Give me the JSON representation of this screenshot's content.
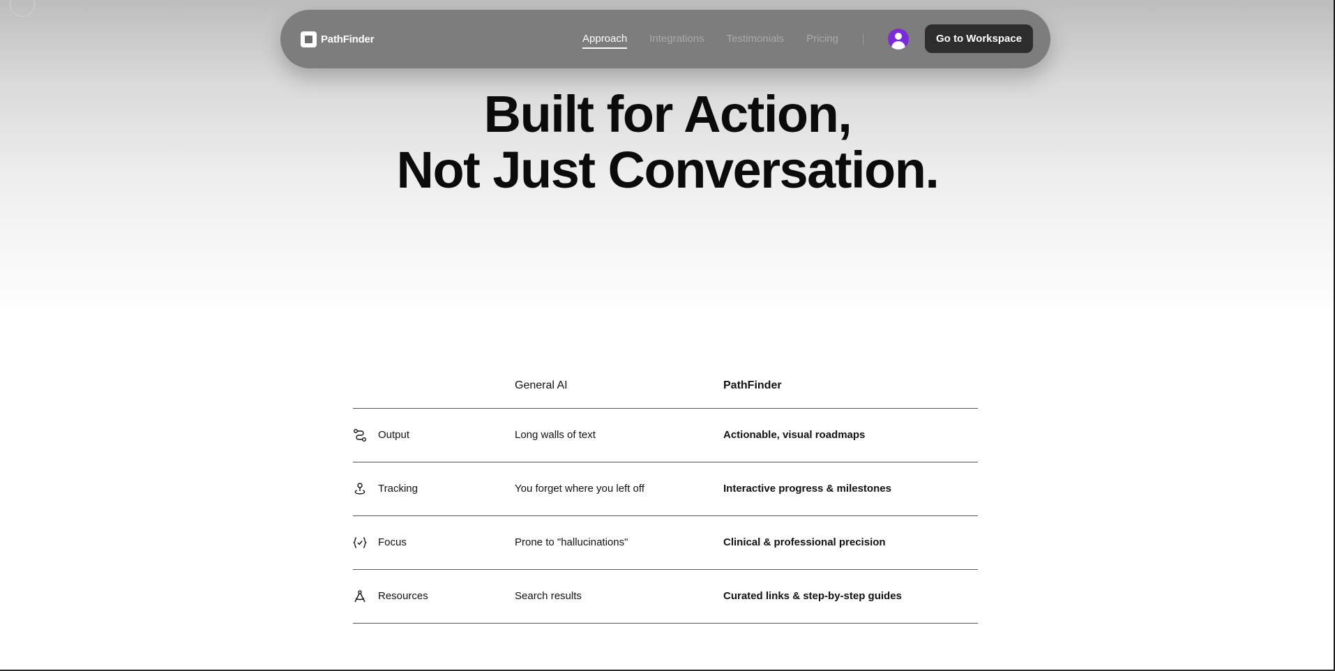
{
  "nav": {
    "brand": "PathFinder",
    "links": [
      "Approach",
      "Integrations",
      "Testimonials",
      "Pricing"
    ],
    "active_link": "Approach",
    "cta": "Go to Workspace"
  },
  "hero": {
    "line1": "Built for Action,",
    "line2": "Not Just Conversation."
  },
  "comparison": {
    "headers": [
      "",
      "General AI",
      "PathFinder"
    ],
    "rows": [
      {
        "icon": "route-icon",
        "label": "Output",
        "general": "Long walls of text",
        "pathfinder": "Actionable, visual roadmaps"
      },
      {
        "icon": "map-pin-icon",
        "label": "Tracking",
        "general": "You forget where you left off",
        "pathfinder": "Interactive progress & milestones"
      },
      {
        "icon": "braces-check-icon",
        "label": "Focus",
        "general": "Prone to \"hallucinations\"",
        "pathfinder": "Clinical & professional precision"
      },
      {
        "icon": "compass-icon",
        "label": "Resources",
        "general": "Search results",
        "pathfinder": "Curated links & step-by-step guides"
      }
    ]
  },
  "colors": {
    "nav_bg": "#7d7d7d",
    "cta_bg": "#2d2d2d",
    "avatar": "#7b2bd9"
  }
}
